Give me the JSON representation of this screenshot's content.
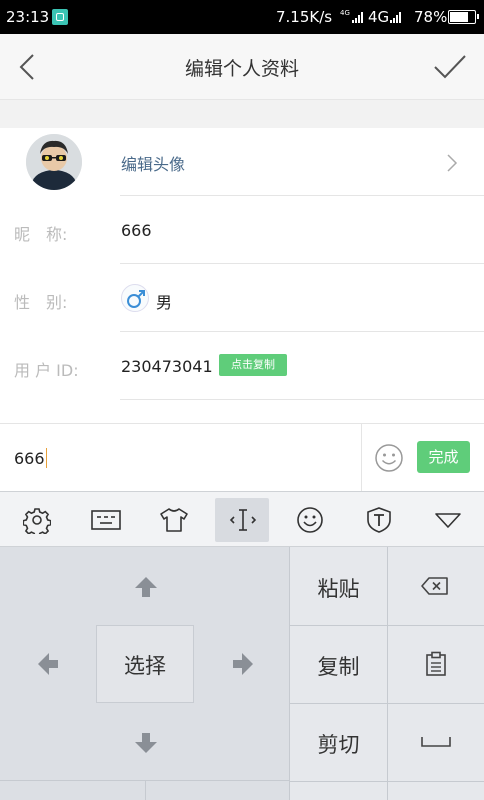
{
  "status_bar": {
    "time": "23:13",
    "net_speed": "7.15K/s",
    "net_small": "4G",
    "network": "4G",
    "battery_text": "78%",
    "battery_level": 0.78
  },
  "nav": {
    "title": "编辑个人资料"
  },
  "profile": {
    "edit_avatar_label": "编辑头像",
    "nickname_label": "昵　称:",
    "nickname_value": "666",
    "gender_label": "性　别:",
    "gender_value": "男",
    "user_id_label": "用 户 ID:",
    "user_id_value": "230473041",
    "copy_button": "点击复制"
  },
  "input": {
    "value": "666",
    "done_button": "完成"
  },
  "keyboard": {
    "toolbar_icons": [
      "gear-icon",
      "keyboard-icon",
      "skin-icon",
      "cursor-icon",
      "emoji-icon",
      "font-icon",
      "collapse-icon"
    ],
    "select_label": "选择",
    "paste_label": "粘贴",
    "copy_label": "复制",
    "cut_label": "剪切"
  },
  "colors": {
    "accent_green": "#5fcd7a",
    "link_blue": "#4a6a8a"
  }
}
